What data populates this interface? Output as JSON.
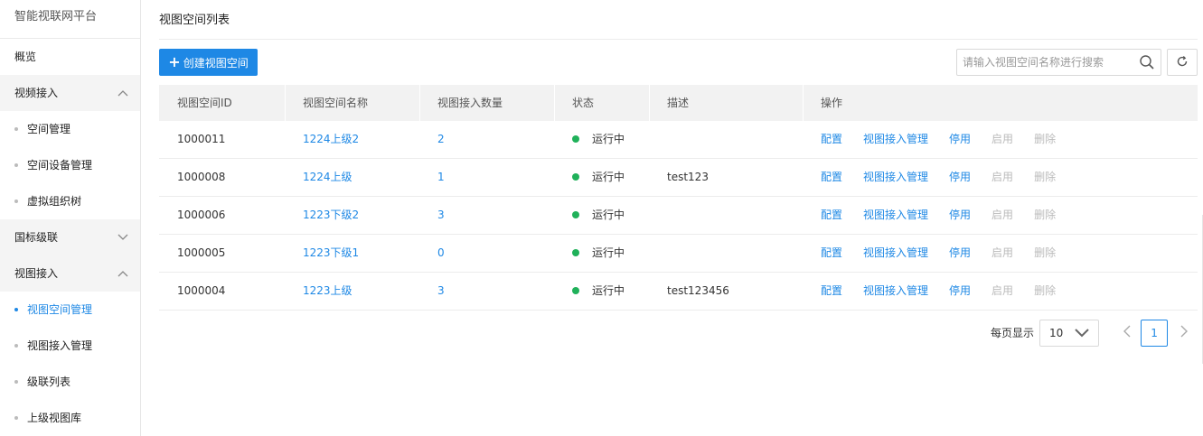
{
  "app": {
    "title": "智能视联网平台"
  },
  "sidebar": {
    "overview": "概览",
    "groups": [
      {
        "label": "视频接入",
        "expanded": true,
        "items": [
          "空间管理",
          "空间设备管理",
          "虚拟组织树"
        ]
      },
      {
        "label": "国标级联",
        "expanded": false,
        "items": []
      },
      {
        "label": "视图接入",
        "expanded": true,
        "items": [
          "视图空间管理",
          "视图接入管理",
          "级联列表",
          "上级视图库"
        ]
      }
    ],
    "active_item": "视图空间管理"
  },
  "main": {
    "title": "视图空间列表",
    "create_button": "创建视图空间",
    "search": {
      "placeholder": "请输入视图空间名称进行搜索",
      "value": ""
    },
    "table": {
      "headers": [
        "视图空间ID",
        "视图空间名称",
        "视图接入数量",
        "状态",
        "描述",
        "操作"
      ],
      "rows": [
        {
          "id": "1000011",
          "name": "1224上级2",
          "count": "2",
          "status": "运行中",
          "desc": ""
        },
        {
          "id": "1000008",
          "name": "1224上级",
          "count": "1",
          "status": "运行中",
          "desc": "test123"
        },
        {
          "id": "1000006",
          "name": "1223下级2",
          "count": "3",
          "status": "运行中",
          "desc": ""
        },
        {
          "id": "1000005",
          "name": "1223下级1",
          "count": "0",
          "status": "运行中",
          "desc": ""
        },
        {
          "id": "1000004",
          "name": "1223上级",
          "count": "3",
          "status": "运行中",
          "desc": "test123456"
        }
      ],
      "operations": [
        {
          "label": "配置",
          "enabled": true
        },
        {
          "label": "视图接入管理",
          "enabled": true
        },
        {
          "label": "停用",
          "enabled": true
        },
        {
          "label": "启用",
          "enabled": false
        },
        {
          "label": "删除",
          "enabled": false
        }
      ]
    },
    "pagination": {
      "label": "每页显示",
      "page_size": "10",
      "current_page": "1"
    }
  },
  "colors": {
    "accent": "#1e88e5",
    "status_running": "#20b15a",
    "disabled": "#bbbbbb"
  }
}
